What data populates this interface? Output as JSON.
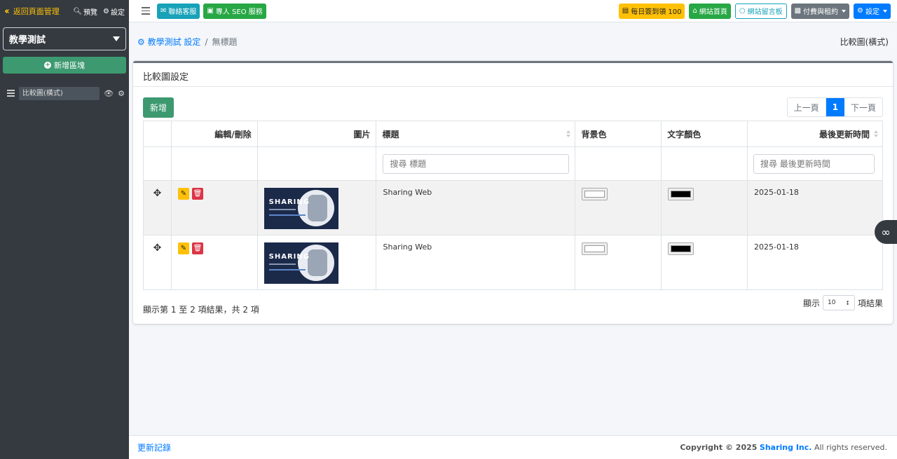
{
  "sidebar": {
    "back_label": "返回頁面管理",
    "preview_label": "預覽",
    "settings_label": "設定",
    "site_select": "教學測試",
    "add_block_label": "新增區塊",
    "items": [
      {
        "label": "比較圖(橫式)"
      }
    ]
  },
  "navbar": {
    "contact_label": "聯絡客服",
    "seo_label": "專人 SEO 服務",
    "checkin_label": "每日簽到領 100",
    "home_label": "網站首頁",
    "guestbook_label": "網站留言板",
    "billing_label": "付費與租約",
    "settings_label": "設定"
  },
  "breadcrumb": {
    "parent": "教學測試 設定",
    "current": "無標題",
    "right_title": "比較圖(橫式)"
  },
  "card": {
    "title": "比較圖設定",
    "add_label": "新增",
    "pager": {
      "prev": "上一頁",
      "current": "1",
      "next": "下一頁"
    },
    "columns": [
      "編輯/刪除",
      "圖片",
      "標題",
      "背景色",
      "文字顏色",
      "最後更新時間"
    ],
    "search_title_placeholder": "搜尋 標題",
    "search_date_placeholder": "搜尋 最後更新時間",
    "rows": [
      {
        "image_brand": "SHARING",
        "title": "Sharing Web",
        "bg_color": "#ffffff",
        "text_color": "#000000",
        "updated": "2025-01-18"
      },
      {
        "image_brand": "SHARING",
        "title": "Sharing Web",
        "bg_color": "#ffffff",
        "text_color": "#000000",
        "updated": "2025-01-18"
      }
    ],
    "info": "顯示第 1 至 2 項結果，共 2 項",
    "length_prefix": "顯示",
    "length_value": "10",
    "length_suffix": "項結果"
  },
  "footer": {
    "changelog": "更新記錄",
    "copyright_prefix": "Copyright © 2025",
    "copyright_brand": "Sharing Inc.",
    "copyright_suffix": "All rights reserved."
  }
}
